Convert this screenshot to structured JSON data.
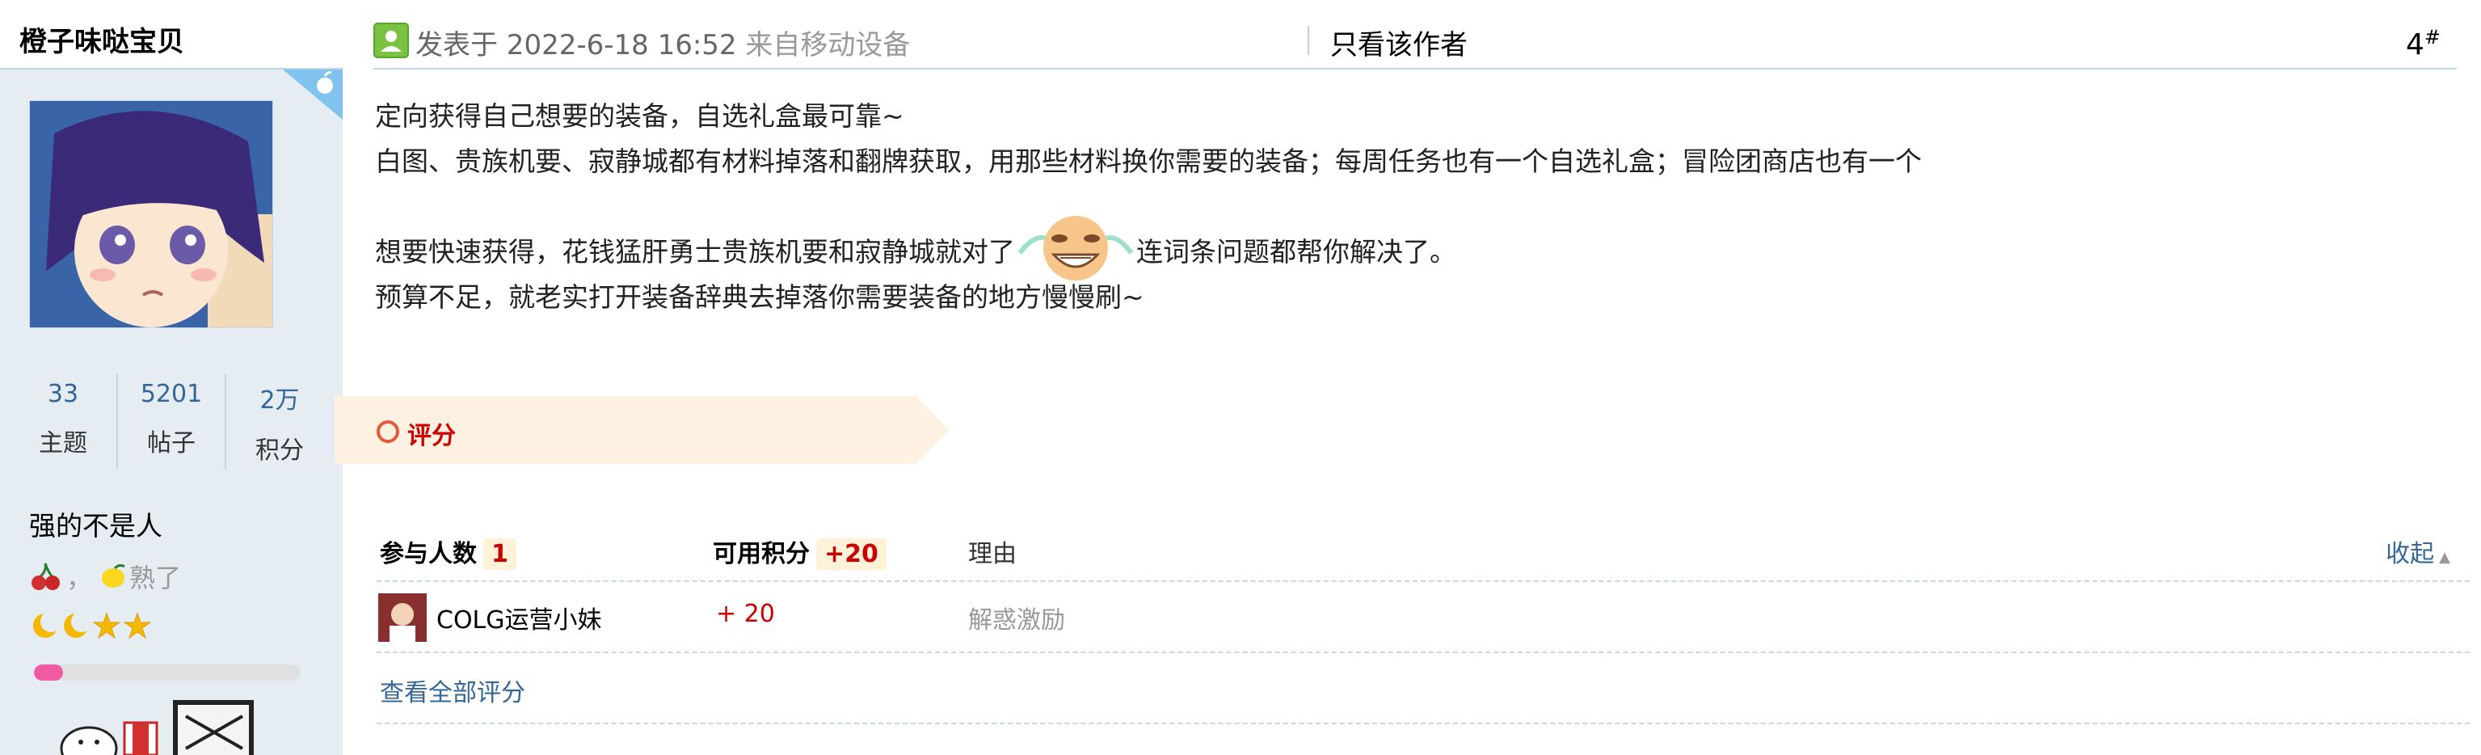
{
  "author": {
    "name": "橙子味哒宝贝",
    "stats": [
      {
        "value": "33",
        "label": "主题"
      },
      {
        "value": "5201",
        "label": "帖子"
      },
      {
        "value": "2万",
        "label": "积分"
      }
    ],
    "group": "强的不是人",
    "medal_sep": "，",
    "medal_text": "熟了",
    "level_progress": 0.11,
    "colors": {
      "sidebar_bg": "#e5edf2",
      "ribbon": "#7fc3ee",
      "level_fill": "#f05aa0"
    },
    "icons": [
      "cherry-icon",
      "lemon-icon",
      "moon-icon",
      "moon-icon",
      "star-icon",
      "star-icon"
    ]
  },
  "post": {
    "posted_prefix": "发表于 2022-6-18 16:52",
    "posted_source": "来自移动设备",
    "only_author": "只看该作者",
    "floor": "4",
    "floor_sup": "#",
    "lines": {
      "l1": "定向获得自己想要的装备，自选礼盒最可靠~",
      "l2": "白图、贵族机要、寂静城都有材料掉落和翻牌获取，用那些材料换你需要的装备；每周任务也有一个自选礼盒；冒险团商店也有一个",
      "l3a": "想要快速获得，花钱猛肝勇士贵族机要和寂静城就对了",
      "l3b": "连词条问题都帮你解决了。",
      "l4": "预算不足，就老实打开装备辞典去掉落你需要装备的地方慢慢刷~"
    }
  },
  "rating": {
    "tab_label": "评分",
    "participants_label": "参与人数",
    "participants_count": "1",
    "points_label": "可用积分",
    "points_value": "+20",
    "reason_label": "理由",
    "collapse_label": "收起",
    "rows": [
      {
        "user": "COLG运营小妹",
        "score": "+ 20",
        "reason": "解惑激励"
      }
    ],
    "view_all": "查看全部评分"
  }
}
